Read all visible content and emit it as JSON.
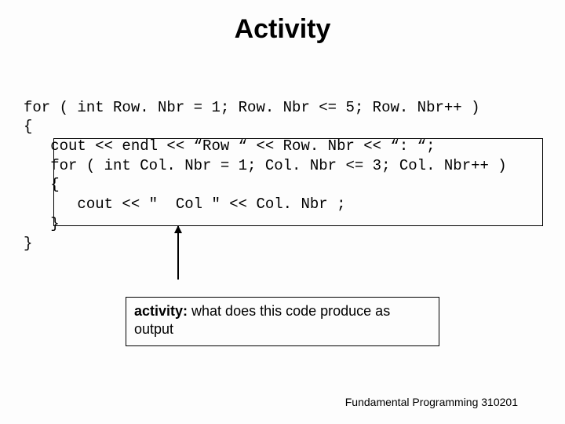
{
  "title": "Activity",
  "code": {
    "l1": "for ( int Row. Nbr = 1; Row. Nbr <= 5; Row. Nbr++ )",
    "l2": "{",
    "l3": "   cout << endl << “Row “ << Row. Nbr << “: “;",
    "l4": "   for ( int Col. Nbr = 1; Col. Nbr <= 3; Col. Nbr++ )",
    "l5": "   {",
    "l6": "      cout << \"  Col \" << Col. Nbr ;",
    "l7": "   }",
    "l8": "}"
  },
  "activity": {
    "label": "activity:",
    "text": " what does this code produce as output"
  },
  "footer": "Fundamental Programming 310201"
}
